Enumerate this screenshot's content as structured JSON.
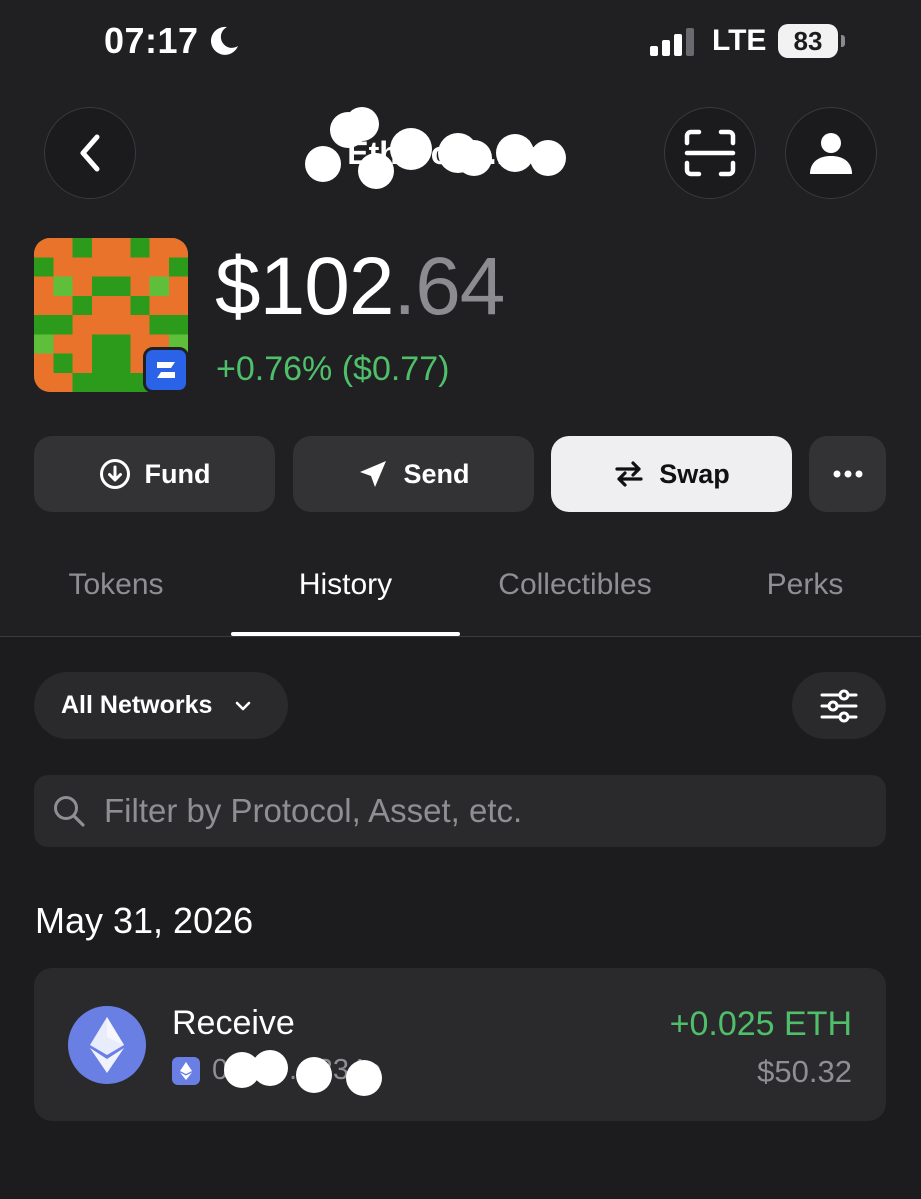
{
  "status_bar": {
    "time": "07:17",
    "moon_icon": "moon-icon",
    "signal_icon": "cellular-signal-icon",
    "network": "LTE",
    "battery": "83"
  },
  "header": {
    "back_icon": "chevron-left-icon",
    "account_name": "Eth Dom ... h",
    "scan_icon": "scan-icon",
    "profile_icon": "person-icon"
  },
  "wallet": {
    "balance_whole": "$102",
    "balance_cents": ".64",
    "change": "+0.76% ($0.77)",
    "badge_icon": "zerion-logo-icon"
  },
  "actions": {
    "fund": "Fund",
    "send": "Send",
    "swap": "Swap",
    "more_icon": "more-horizontal-icon"
  },
  "tabs": [
    {
      "label": "Tokens"
    },
    {
      "label": "History"
    },
    {
      "label": "Collectibles"
    },
    {
      "label": "Perks"
    }
  ],
  "active_tab": "History",
  "filters": {
    "network": "All Networks",
    "search_placeholder": "Filter by Protocol, Asset, etc."
  },
  "history": {
    "date": "May 31, 2026",
    "items": [
      {
        "type": "Receive",
        "address": "0x…b…334e",
        "amount": "+0.025 ETH",
        "usd": "$50.32",
        "icon": "ethereum-icon"
      }
    ]
  },
  "colors": {
    "background": "#1c1c1f",
    "header_background": "#202023",
    "positive": "#4fbf6a",
    "muted": "#8e8e93",
    "ethereum": "#6a7fe4",
    "badge": "#2b63e8",
    "avatar_orange": "#e9732b",
    "avatar_green": "#2c9a1b"
  }
}
